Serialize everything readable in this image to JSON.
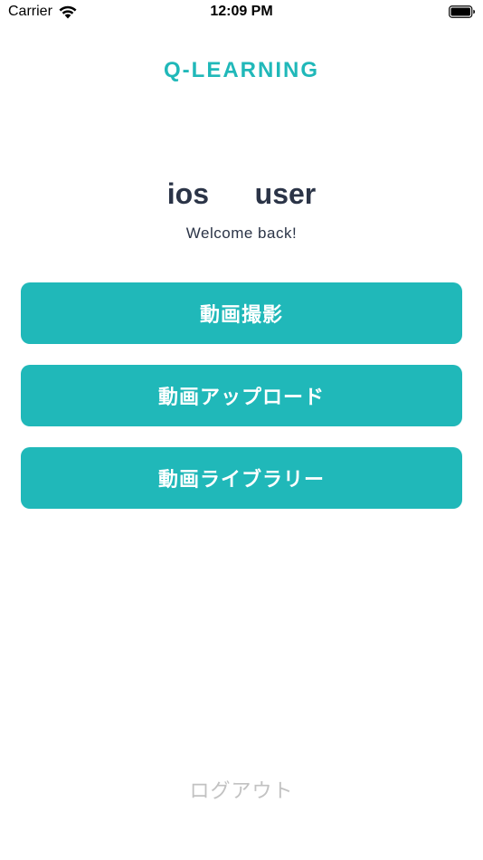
{
  "status_bar": {
    "carrier": "Carrier",
    "time": "12:09 PM",
    "wifi_icon": "wifi-icon",
    "battery_icon": "battery-icon"
  },
  "brand": {
    "title": "Q-LEARNING",
    "color": "#20b8b9"
  },
  "user": {
    "name": "ios   user",
    "greeting": "Welcome back!"
  },
  "actions": [
    {
      "label": "動画撮影"
    },
    {
      "label": "動画アップロード"
    },
    {
      "label": "動画ライブラリー"
    }
  ],
  "logout": {
    "label": "ログアウト"
  },
  "colors": {
    "accent": "#20b8b9",
    "text_dark": "#2b3447",
    "muted": "#c2c2c2"
  }
}
